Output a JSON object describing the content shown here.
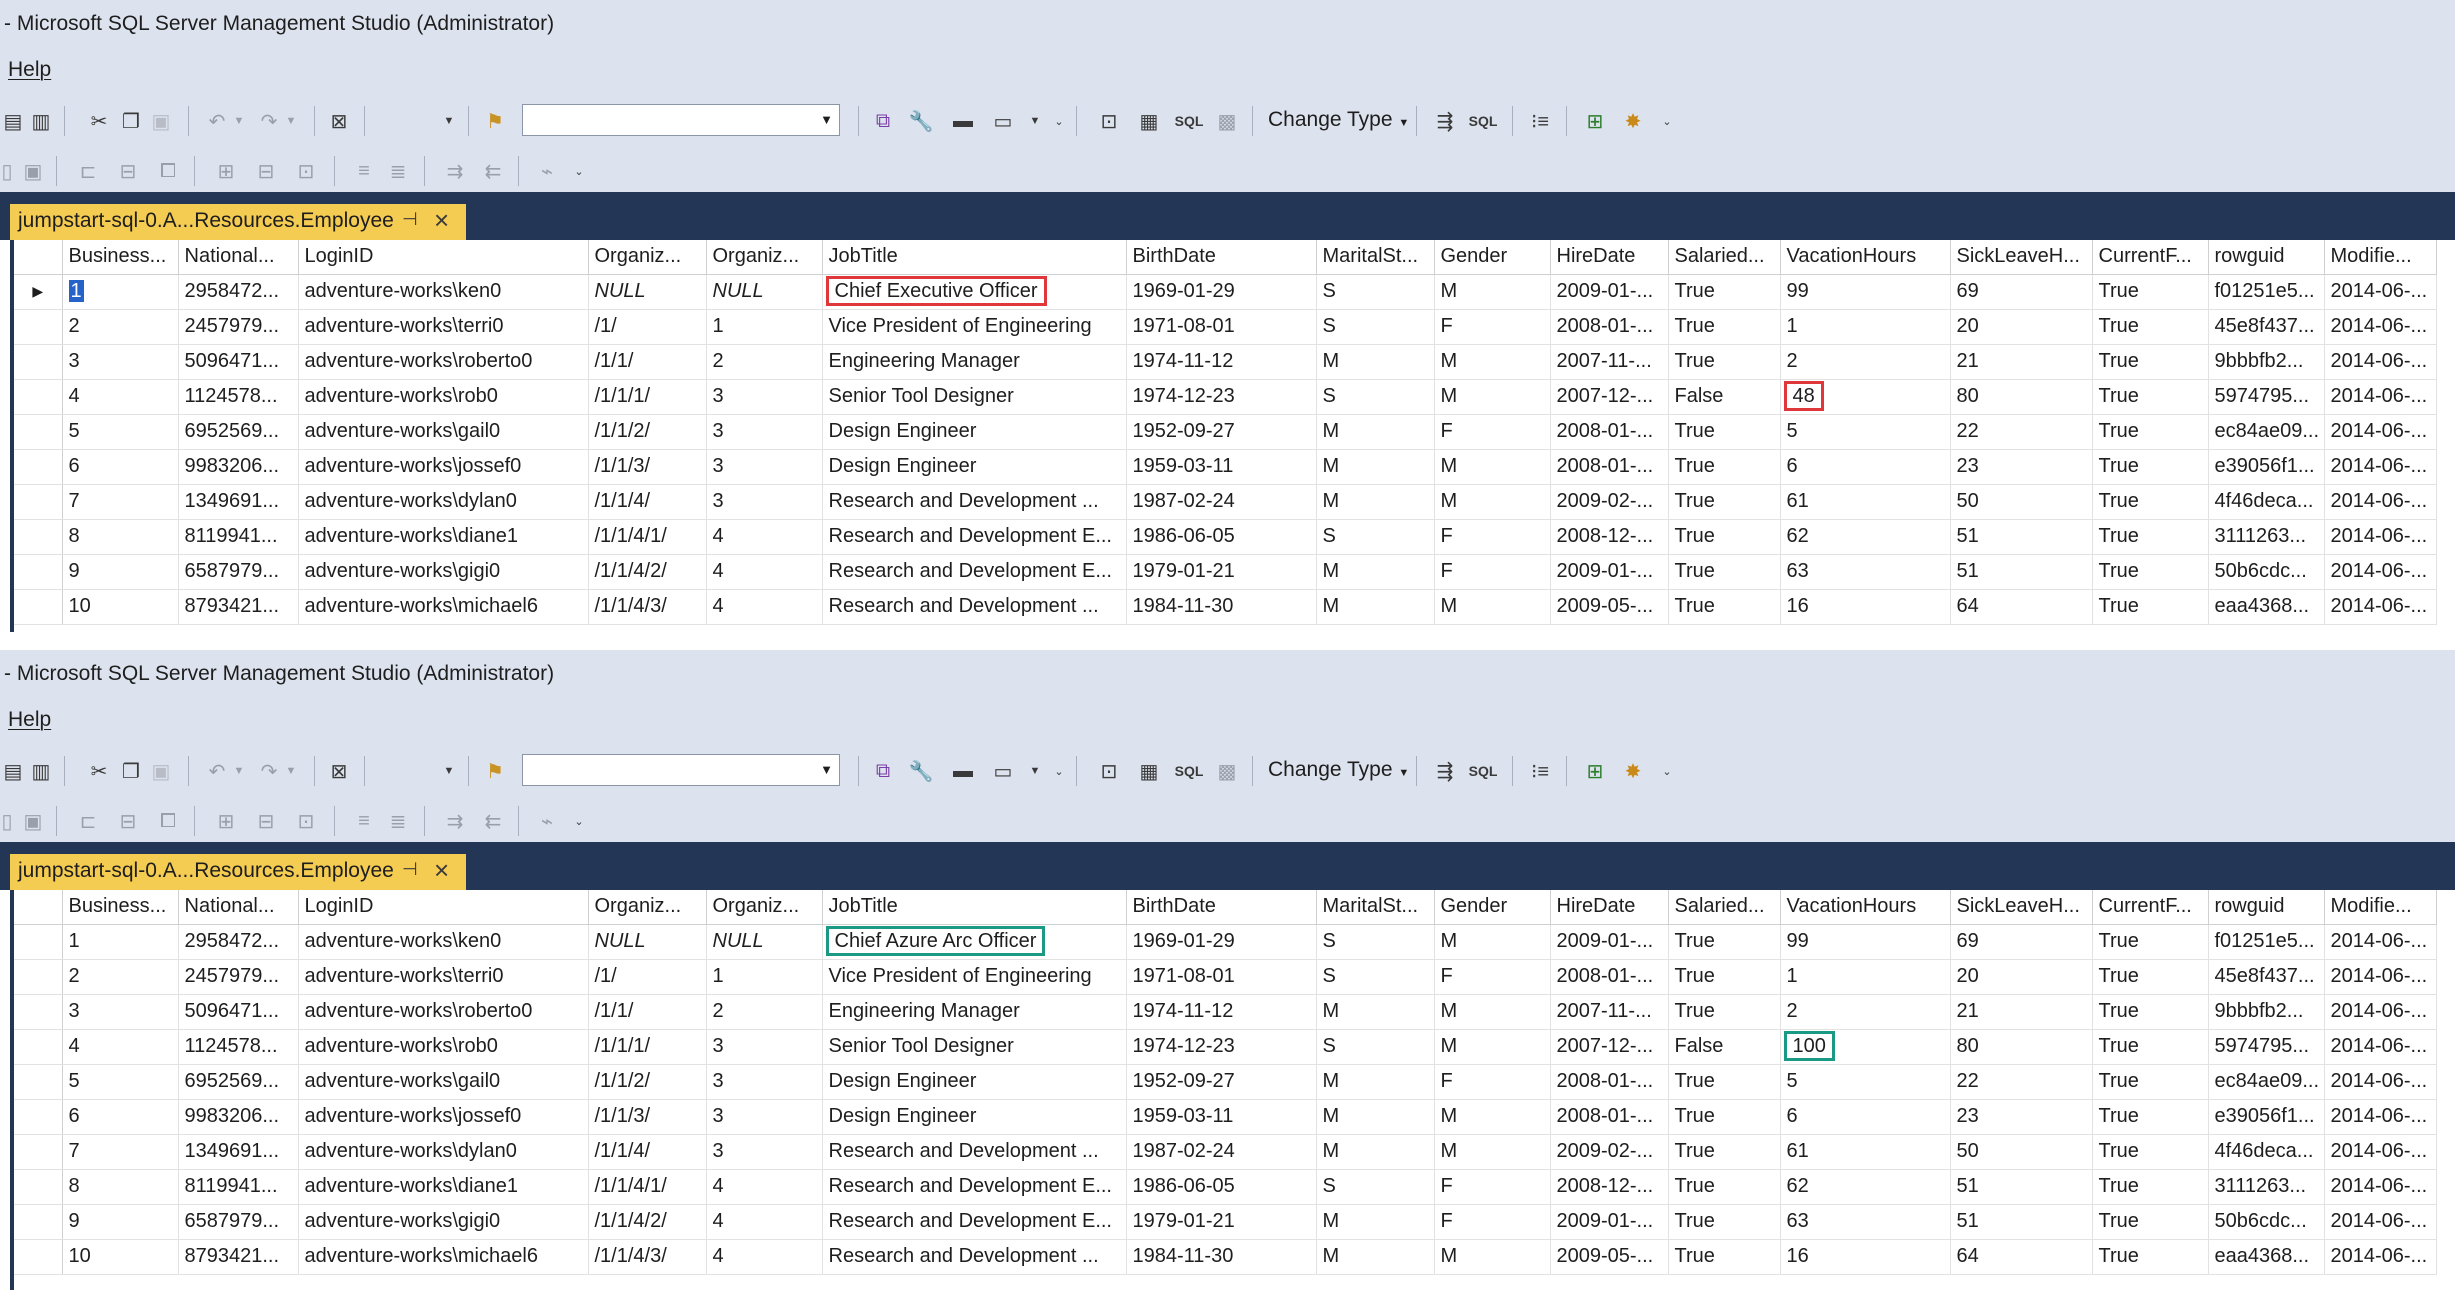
{
  "panels": [
    {
      "window_title": "- Microsoft SQL Server Management Studio (Administrator)",
      "menu": [
        "Help"
      ],
      "toolbar": {
        "change_type_label": "Change Type",
        "query_combo_value": ""
      },
      "tab": {
        "title": "jumpstart-sql-0.A...Resources.Employee"
      },
      "grid": {
        "columns": [
          "Business...",
          "National...",
          "LoginID",
          "Organiz...",
          "Organiz...",
          "JobTitle",
          "BirthDate",
          "MaritalSt...",
          "Gender",
          "HireDate",
          "Salaried...",
          "VacationHours",
          "SickLeaveH...",
          "CurrentF...",
          "rowguid",
          "Modifie..."
        ],
        "rows": [
          [
            "1",
            "2958472...",
            "adventure-works\\ken0",
            "NULL",
            "NULL",
            "Chief Executive Officer",
            "1969-01-29",
            "S",
            "M",
            "2009-01-...",
            "True",
            "99",
            "69",
            "True",
            "f01251e5...",
            "2014-06-..."
          ],
          [
            "2",
            "2457979...",
            "adventure-works\\terri0",
            "/1/",
            "1",
            "Vice President of Engineering",
            "1971-08-01",
            "S",
            "F",
            "2008-01-...",
            "True",
            "1",
            "20",
            "True",
            "45e8f437...",
            "2014-06-..."
          ],
          [
            "3",
            "5096471...",
            "adventure-works\\roberto0",
            "/1/1/",
            "2",
            "Engineering Manager",
            "1974-11-12",
            "M",
            "M",
            "2007-11-...",
            "True",
            "2",
            "21",
            "True",
            "9bbbfb2...",
            "2014-06-..."
          ],
          [
            "4",
            "1124578...",
            "adventure-works\\rob0",
            "/1/1/1/",
            "3",
            "Senior Tool Designer",
            "1974-12-23",
            "S",
            "M",
            "2007-12-...",
            "False",
            "48",
            "80",
            "True",
            "5974795...",
            "2014-06-..."
          ],
          [
            "5",
            "6952569...",
            "adventure-works\\gail0",
            "/1/1/2/",
            "3",
            "Design Engineer",
            "1952-09-27",
            "M",
            "F",
            "2008-01-...",
            "True",
            "5",
            "22",
            "True",
            "ec84ae09...",
            "2014-06-..."
          ],
          [
            "6",
            "9983206...",
            "adventure-works\\jossef0",
            "/1/1/3/",
            "3",
            "Design Engineer",
            "1959-03-11",
            "M",
            "M",
            "2008-01-...",
            "True",
            "6",
            "23",
            "True",
            "e39056f1...",
            "2014-06-..."
          ],
          [
            "7",
            "1349691...",
            "adventure-works\\dylan0",
            "/1/1/4/",
            "3",
            "Research and Development ...",
            "1987-02-24",
            "M",
            "M",
            "2009-02-...",
            "True",
            "61",
            "50",
            "True",
            "4f46deca...",
            "2014-06-..."
          ],
          [
            "8",
            "8119941...",
            "adventure-works\\diane1",
            "/1/1/4/1/",
            "4",
            "Research and Development E...",
            "1986-06-05",
            "S",
            "F",
            "2008-12-...",
            "True",
            "62",
            "51",
            "True",
            "3111263...",
            "2014-06-..."
          ],
          [
            "9",
            "6587979...",
            "adventure-works\\gigi0",
            "/1/1/4/2/",
            "4",
            "Research and Development E...",
            "1979-01-21",
            "M",
            "F",
            "2009-01-...",
            "True",
            "63",
            "51",
            "True",
            "50b6cdc...",
            "2014-06-..."
          ],
          [
            "10",
            "8793421...",
            "adventure-works\\michael6",
            "/1/1/4/3/",
            "4",
            "Research and Development ...",
            "1984-11-30",
            "M",
            "M",
            "2009-05-...",
            "True",
            "16",
            "64",
            "True",
            "eaa4368...",
            "2014-06-..."
          ]
        ],
        "current_row": 0,
        "highlights": [
          {
            "row": 0,
            "col": 5,
            "color": "#e0383a"
          },
          {
            "row": 3,
            "col": 11,
            "color": "#e0383a"
          }
        ]
      }
    },
    {
      "window_title": "- Microsoft SQL Server Management Studio (Administrator)",
      "menu": [
        "Help"
      ],
      "toolbar": {
        "change_type_label": "Change Type",
        "query_combo_value": ""
      },
      "tab": {
        "title": "jumpstart-sql-0.A...Resources.Employee"
      },
      "grid": {
        "columns": [
          "Business...",
          "National...",
          "LoginID",
          "Organiz...",
          "Organiz...",
          "JobTitle",
          "BirthDate",
          "MaritalSt...",
          "Gender",
          "HireDate",
          "Salaried...",
          "VacationHours",
          "SickLeaveH...",
          "CurrentF...",
          "rowguid",
          "Modifie..."
        ],
        "rows": [
          [
            "1",
            "2958472...",
            "adventure-works\\ken0",
            "NULL",
            "NULL",
            "Chief Azure Arc Officer",
            "1969-01-29",
            "S",
            "M",
            "2009-01-...",
            "True",
            "99",
            "69",
            "True",
            "f01251e5...",
            "2014-06-..."
          ],
          [
            "2",
            "2457979...",
            "adventure-works\\terri0",
            "/1/",
            "1",
            "Vice President of Engineering",
            "1971-08-01",
            "S",
            "F",
            "2008-01-...",
            "True",
            "1",
            "20",
            "True",
            "45e8f437...",
            "2014-06-..."
          ],
          [
            "3",
            "5096471...",
            "adventure-works\\roberto0",
            "/1/1/",
            "2",
            "Engineering Manager",
            "1974-11-12",
            "M",
            "M",
            "2007-11-...",
            "True",
            "2",
            "21",
            "True",
            "9bbbfb2...",
            "2014-06-..."
          ],
          [
            "4",
            "1124578...",
            "adventure-works\\rob0",
            "/1/1/1/",
            "3",
            "Senior Tool Designer",
            "1974-12-23",
            "S",
            "M",
            "2007-12-...",
            "False",
            "100",
            "80",
            "True",
            "5974795...",
            "2014-06-..."
          ],
          [
            "5",
            "6952569...",
            "adventure-works\\gail0",
            "/1/1/2/",
            "3",
            "Design Engineer",
            "1952-09-27",
            "M",
            "F",
            "2008-01-...",
            "True",
            "5",
            "22",
            "True",
            "ec84ae09...",
            "2014-06-..."
          ],
          [
            "6",
            "9983206...",
            "adventure-works\\jossef0",
            "/1/1/3/",
            "3",
            "Design Engineer",
            "1959-03-11",
            "M",
            "M",
            "2008-01-...",
            "True",
            "6",
            "23",
            "True",
            "e39056f1...",
            "2014-06-..."
          ],
          [
            "7",
            "1349691...",
            "adventure-works\\dylan0",
            "/1/1/4/",
            "3",
            "Research and Development ...",
            "1987-02-24",
            "M",
            "M",
            "2009-02-...",
            "True",
            "61",
            "50",
            "True",
            "4f46deca...",
            "2014-06-..."
          ],
          [
            "8",
            "8119941...",
            "adventure-works\\diane1",
            "/1/1/4/1/",
            "4",
            "Research and Development E...",
            "1986-06-05",
            "S",
            "F",
            "2008-12-...",
            "True",
            "62",
            "51",
            "True",
            "3111263...",
            "2014-06-..."
          ],
          [
            "9",
            "6587979...",
            "adventure-works\\gigi0",
            "/1/1/4/2/",
            "4",
            "Research and Development E...",
            "1979-01-21",
            "M",
            "F",
            "2009-01-...",
            "True",
            "63",
            "51",
            "True",
            "50b6cdc...",
            "2014-06-..."
          ],
          [
            "10",
            "8793421...",
            "adventure-works\\michael6",
            "/1/1/4/3/",
            "4",
            "Research and Development ...",
            "1984-11-30",
            "M",
            "M",
            "2009-05-...",
            "True",
            "16",
            "64",
            "True",
            "eaa4368...",
            "2014-06-..."
          ]
        ],
        "current_row": -1,
        "highlights": [
          {
            "row": 0,
            "col": 5,
            "color": "#1a9a84"
          },
          {
            "row": 3,
            "col": 11,
            "color": "#1a9a84"
          }
        ]
      }
    }
  ],
  "toolbar_icons": {
    "row1": [
      "xmla-query-icon",
      "dax-query-icon",
      "cut-icon",
      "copy-icon",
      "paste-icon",
      "undo-icon",
      "undo-dropdown-icon",
      "redo-icon",
      "redo-dropdown-icon",
      "activity-monitor-icon",
      "object-explorer-dropdown-icon",
      "find-icon",
      "object-browser-icon",
      "properties-icon",
      "toolbox-icon",
      "command-window-icon",
      "toolbar-options-icon",
      "show-diagram-pane-icon",
      "show-criteria-pane-icon",
      "show-sql-pane-icon",
      "show-results-pane-icon",
      "execute-sql-icon",
      "verify-sql-icon",
      "add-group-by-icon",
      "add-table-icon",
      "add-new-derived-table-icon"
    ],
    "row2": [
      "layout-icon",
      "save-icon",
      "align-lefts-icon",
      "align-centers-icon",
      "align-rights-icon",
      "make-same-width-icon",
      "make-same-height-icon",
      "make-same-size-icon",
      "horizontal-spacing-icon",
      "vertical-spacing-icon",
      "increase-indent-icon",
      "decrease-indent-icon",
      "tab-order-icon"
    ]
  },
  "colors": {
    "chrome_bg": "#dde3ee",
    "dark_bar": "#243655",
    "tab_active": "#f5cc52",
    "highlight_top": "#e0383a",
    "highlight_bottom": "#1a9a84",
    "org_level_text": "#b06b3a"
  }
}
